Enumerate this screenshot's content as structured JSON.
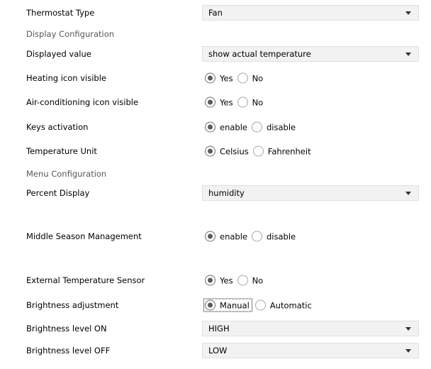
{
  "thermostat_type": {
    "label": "Thermostat Type",
    "value": "Fan"
  },
  "display_section": "Display Configuration",
  "displayed_value": {
    "label": "Displayed value",
    "value": "show actual temperature"
  },
  "heating_icon": {
    "label": "Heating icon visible",
    "options": [
      "Yes",
      "No"
    ],
    "selected": "Yes"
  },
  "ac_icon": {
    "label": "Air-conditioning icon visible",
    "options": [
      "Yes",
      "No"
    ],
    "selected": "Yes"
  },
  "keys_activation": {
    "label": "Keys activation",
    "options": [
      "enable",
      "disable"
    ],
    "selected": "enable"
  },
  "temperature_unit": {
    "label": "Temperature Unit",
    "options": [
      "Celsius",
      "Fahrenheit"
    ],
    "selected": "Celsius"
  },
  "menu_section": "Menu Configuration",
  "percent_display": {
    "label": "Percent Display",
    "value": "humidity"
  },
  "middle_season": {
    "label": "Middle Season Management",
    "options": [
      "enable",
      "disable"
    ],
    "selected": "enable"
  },
  "external_sensor": {
    "label": "External Temperature Sensor",
    "options": [
      "Yes",
      "No"
    ],
    "selected": "Yes"
  },
  "brightness_adjustment": {
    "label": "Brightness adjustment",
    "options": [
      "Manual",
      "Automatic"
    ],
    "selected": "Manual"
  },
  "brightness_on": {
    "label": "Brightness level ON",
    "value": "HIGH"
  },
  "brightness_off": {
    "label": "Brightness level OFF",
    "value": "LOW"
  }
}
